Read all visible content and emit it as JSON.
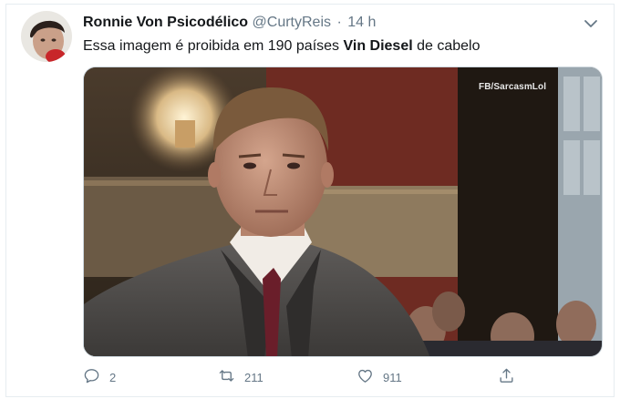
{
  "tweet": {
    "author_name": "Ronnie Von Psicodélico",
    "handle": "@CurtyReis",
    "separator": "·",
    "time": "14 h",
    "text_before": "Essa imagem é proibida em 190 países ",
    "text_bold": "Vin Diesel",
    "text_after": " de cabelo",
    "image_watermark": "FB/SarcasmLol"
  },
  "actions": {
    "replies": "2",
    "retweets": "211",
    "likes": "911"
  },
  "icons": {
    "more": "chevron-down-icon",
    "reply": "reply-icon",
    "retweet": "retweet-icon",
    "like": "heart-icon",
    "share": "share-icon"
  },
  "colors": {
    "muted": "#657786",
    "text": "#14171a",
    "border": "#e6ecf0"
  }
}
